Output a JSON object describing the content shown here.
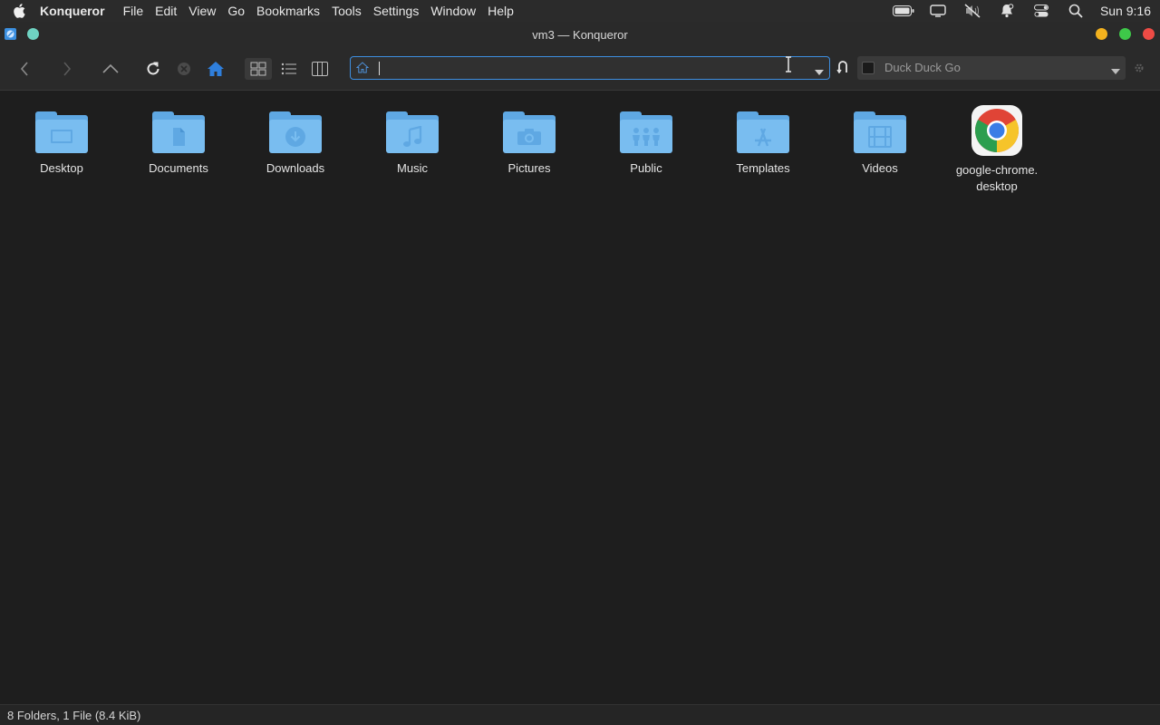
{
  "menubar": {
    "app_name": "Konqueror",
    "menus": [
      "File",
      "Edit",
      "View",
      "Go",
      "Bookmarks",
      "Tools",
      "Settings",
      "Window",
      "Help"
    ],
    "clock": "Sun 9:16",
    "status_icons": [
      "battery-icon",
      "display-icon",
      "mute-icon",
      "notification-icon",
      "control-center-icon",
      "search-icon"
    ]
  },
  "window": {
    "title": "vm3 — Konqueror"
  },
  "toolbar": {
    "url_value": "",
    "search_engine": "Duck Duck Go",
    "accent_color": "#3d8ee0"
  },
  "files": [
    {
      "name": "Desktop",
      "icon": "desktop-folder-icon"
    },
    {
      "name": "Documents",
      "icon": "documents-folder-icon"
    },
    {
      "name": "Downloads",
      "icon": "downloads-folder-icon"
    },
    {
      "name": "Music",
      "icon": "music-folder-icon"
    },
    {
      "name": "Pictures",
      "icon": "pictures-folder-icon"
    },
    {
      "name": "Public",
      "icon": "public-folder-icon"
    },
    {
      "name": "Templates",
      "icon": "templates-folder-icon"
    },
    {
      "name": "Videos",
      "icon": "videos-folder-icon"
    },
    {
      "name": "google-chrome.\ndesktop",
      "icon": "google-chrome-icon"
    }
  ],
  "status": {
    "summary": "8 Folders, 1 File (8.4 KiB)"
  },
  "colors": {
    "folder_light": "#79bdf0",
    "folder_dark": "#5fa8e3",
    "background": "#1e1e1e"
  }
}
